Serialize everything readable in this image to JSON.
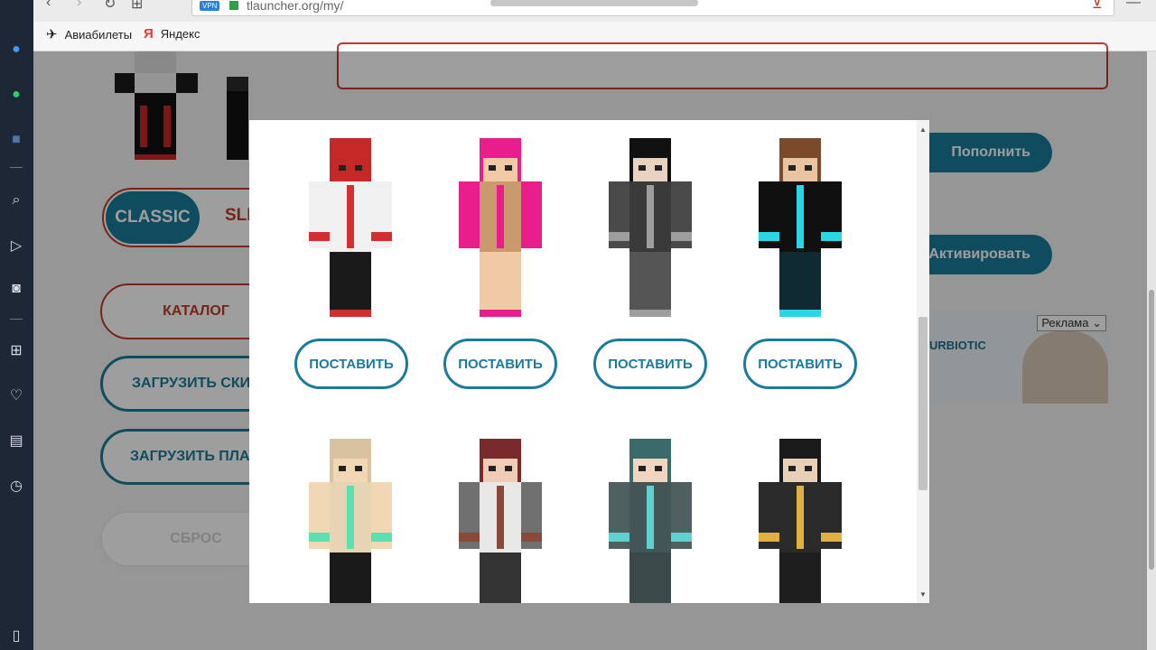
{
  "browser": {
    "url": "tlauncher.org/my/",
    "vpn_badge": "VPN",
    "bookmarks": [
      {
        "label": "Авиабилеты",
        "icon": "airplane-icon"
      },
      {
        "label": "Яндекс",
        "icon": "yandex-icon"
      }
    ]
  },
  "sidebar": {
    "icons": [
      "messenger-icon",
      "whatsapp-icon",
      "vk-icon",
      "search-icon",
      "send-icon",
      "camera-icon",
      "grid-icon",
      "heart-icon",
      "news-icon",
      "history-icon",
      "window-icon"
    ]
  },
  "page": {
    "toggle": {
      "classic": "CLASSIC",
      "slim": "SLI"
    },
    "buttons": {
      "catalog": "КАТАЛОГ",
      "upload_skin": "ЗАГРУЗИТЬ СКИ",
      "upload_cloak": "ЗАГРУЗИТЬ ПЛА",
      "faded": "СБРОС"
    },
    "right_buttons": {
      "top_up": "Пополнить",
      "activate": "Активировать"
    },
    "ad": {
      "label": "Реклама",
      "brand": "URBIOTIC"
    }
  },
  "modal": {
    "put_label": "ПОСТАВИТЬ",
    "skins": [
      {
        "id": "red-hood",
        "hair": "#c62828",
        "skin": "#c62828",
        "torso": "#f0f0f0",
        "arms": "#f0f0f0",
        "legs": "#1a1a1a",
        "accent": "#d32f2f"
      },
      {
        "id": "pink-girl",
        "hair": "#e91e8c",
        "skin": "#f1c9a5",
        "torso": "#c99a6b",
        "arms": "#e91e8c",
        "legs": "#f1c9a5",
        "accent": "#e91e8c"
      },
      {
        "id": "gray-suit",
        "hair": "#111111",
        "skin": "#e8d3c0",
        "torso": "#3a3a3a",
        "arms": "#4a4a4a",
        "legs": "#555555",
        "accent": "#9e9e9e"
      },
      {
        "id": "cyan-boy",
        "hair": "#7a4a2a",
        "skin": "#e8c4a0",
        "torso": "#101010",
        "arms": "#101010",
        "legs": "#0f2a33",
        "accent": "#29d6e6"
      },
      {
        "id": "blonde-girl",
        "hair": "#d9c2a0",
        "skin": "#f2d7b5",
        "torso": "#e6d4b5",
        "arms": "#f2d7b5",
        "legs": "#1a1a1a",
        "accent": "#5ce0b0"
      },
      {
        "id": "brown-girl",
        "hair": "#7a2a2a",
        "skin": "#f0cbb5",
        "torso": "#e8e8e8",
        "arms": "#707070",
        "legs": "#333333",
        "accent": "#8a4a3a"
      },
      {
        "id": "teal-goggles",
        "hair": "#3a6a6a",
        "skin": "#f0d6c0",
        "torso": "#445555",
        "arms": "#506060",
        "legs": "#3a4a4a",
        "accent": "#60d0d0"
      },
      {
        "id": "batman",
        "hair": "#1a1a1a",
        "skin": "#e8d0b8",
        "torso": "#2a2a2a",
        "arms": "#2a2a2a",
        "legs": "#1e1e1e",
        "accent": "#e0b040"
      }
    ]
  }
}
